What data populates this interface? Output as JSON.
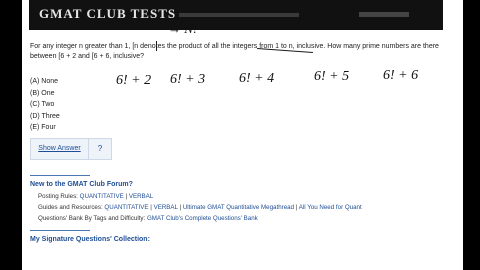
{
  "header": {
    "title": "GMAT CLUB TESTS"
  },
  "question": {
    "text": "For any integer n greater than 1, [n denotes the product of all the integers from 1 to n, inclusive. How many prime numbers are there between [6 + 2 and [6 + 6, inclusive?",
    "options": [
      "(A) None",
      "(B) One",
      "(C) Two",
      "(D) Three",
      "(E) Four"
    ]
  },
  "handwriting": {
    "note_top": "→ N!",
    "terms": [
      "6! + 2",
      "6! + 3",
      "6! + 4",
      "6! + 5",
      "6! + 6"
    ]
  },
  "buttons": {
    "show_answer": "Show Answer",
    "help": "?"
  },
  "forum": {
    "title": "New to the GMAT Club Forum?",
    "posting_rules_label": "Posting Rules:",
    "posting_rules_links": [
      "QUANTITATIVE",
      "VERBAL"
    ],
    "guides_label": "Guides and Resources:",
    "guides_links": [
      "QUANTITATIVE",
      "VERBAL",
      "Ultimate GMAT Quantitative Megathread",
      "All You Need for Quant"
    ],
    "bank_label": "Questions' Bank By Tags and Difficulty:",
    "bank_link": "GMAT Club's Complete Questions' Bank"
  },
  "signature": {
    "title": "My Signature Questions' Collection:"
  }
}
